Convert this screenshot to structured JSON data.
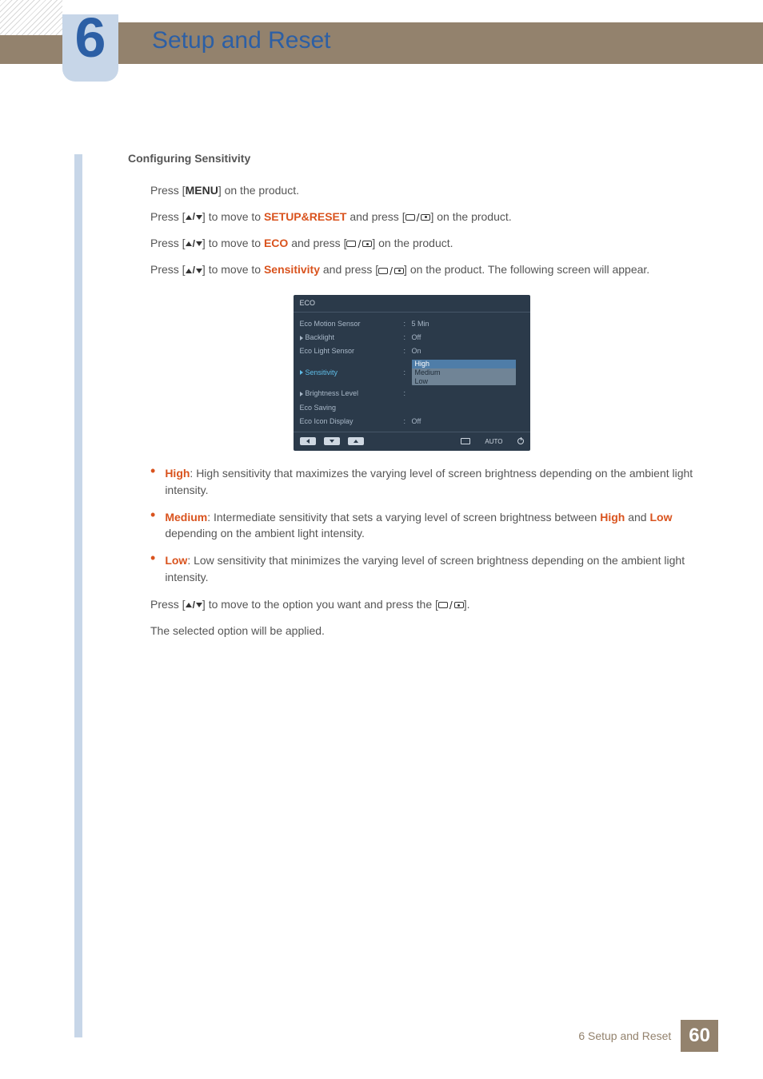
{
  "chapter": {
    "number": "6",
    "title": "Setup and Reset"
  },
  "section_heading": "Configuring Sensitivity",
  "steps": {
    "s1": {
      "pre": "Press [",
      "menu": "MENU",
      "post": "] on the product."
    },
    "s2": {
      "pre": "Press [",
      "mid": "] to move to ",
      "target": "SETUP&RESET",
      "after": " and press [",
      "end": "] on the product."
    },
    "s3": {
      "pre": "Press [",
      "mid": "] to move to ",
      "target": "ECO",
      "after": " and press [",
      "end": "] on the product."
    },
    "s4": {
      "pre": "Press [",
      "mid": "] to move to ",
      "target": "Sensitivity",
      "after": " and press [",
      "end": "] on the product. The following screen will appear."
    }
  },
  "osd": {
    "title": "ECO",
    "rows": {
      "motion": {
        "label": "Eco Motion Sensor",
        "value": "5 Min"
      },
      "backlight": {
        "label": "Backlight",
        "value": "Off"
      },
      "light": {
        "label": "Eco Light Sensor",
        "value": "On"
      },
      "sens": {
        "label": "Sensitivity"
      },
      "bright": {
        "label": "Brightness Level"
      },
      "saving": {
        "label": "Eco Saving"
      },
      "icon": {
        "label": "Eco Icon Display",
        "value": "Off"
      }
    },
    "options": {
      "high": "High",
      "medium": "Medium",
      "low": "Low"
    },
    "auto": "AUTO"
  },
  "bullets": {
    "high": {
      "name": "High",
      "text": ": High sensitivity that maximizes the varying level of screen brightness depending on the ambient light intensity."
    },
    "medium": {
      "name": "Medium",
      "pre": ": Intermediate sensitivity that sets a varying level of screen brightness between ",
      "high": "High",
      "mid": " and ",
      "low": "Low",
      "post": " depending on the ambient light intensity."
    },
    "low": {
      "name": "Low",
      "text": ": Low sensitivity that minimizes the varying level of screen brightness depending on the ambient light intensity."
    }
  },
  "after1": {
    "pre": "Press [",
    "mid": "] to move to the option you want and press the [",
    "end": "]."
  },
  "after2": "The selected option will be applied.",
  "footer": {
    "text": "6 Setup and Reset",
    "page": "60"
  }
}
